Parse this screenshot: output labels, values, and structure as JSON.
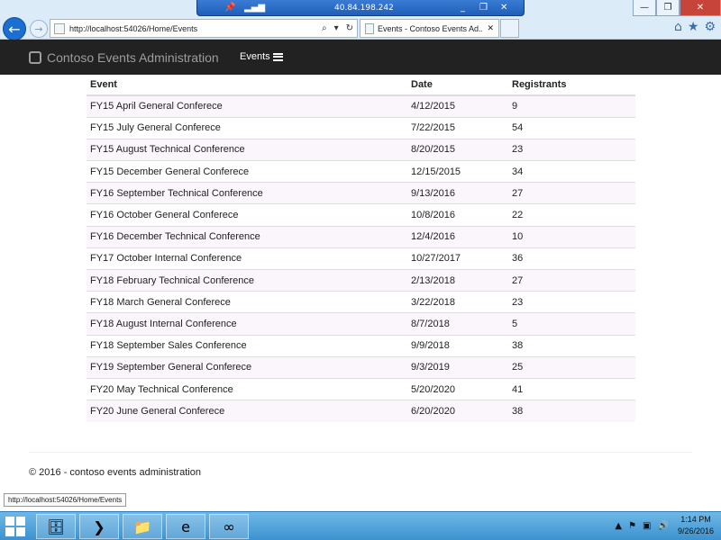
{
  "rdp": {
    "title": "40.84.198.242",
    "pin_icon": "pin-icon",
    "signal_icon": "signal-bars-icon",
    "minimize": "_",
    "restore": "❐",
    "close": "✕"
  },
  "browser": {
    "url": "http://localhost:54026/Home/Events",
    "tab_title": "Events - Contoso Events Ad...",
    "tab_close": "✕",
    "back_icon": "back-arrow-icon",
    "forward_icon": "forward-arrow-icon",
    "tool_icons": [
      "home-icon",
      "star-icon",
      "gear-icon"
    ]
  },
  "window": {
    "minimize": "—",
    "maximize": "❐",
    "close": "✕"
  },
  "navbar": {
    "brand": "Contoso Events Administration",
    "events_link": "Events"
  },
  "table": {
    "headers": {
      "event": "Event",
      "date": "Date",
      "registrants": "Registrants"
    },
    "rows": [
      {
        "event": "FY15 April General Conferece",
        "date": "4/12/2015",
        "registrants": "9"
      },
      {
        "event": "FY15 July General Conferece",
        "date": "7/22/2015",
        "registrants": "54"
      },
      {
        "event": "FY15 August Technical Conference",
        "date": "8/20/2015",
        "registrants": "23"
      },
      {
        "event": "FY15 December General Conferece",
        "date": "12/15/2015",
        "registrants": "34"
      },
      {
        "event": "FY16 September Technical Conference",
        "date": "9/13/2016",
        "registrants": "27"
      },
      {
        "event": "FY16 October General Conferece",
        "date": "10/8/2016",
        "registrants": "22"
      },
      {
        "event": "FY16 December Technical Conference",
        "date": "12/4/2016",
        "registrants": "10"
      },
      {
        "event": "FY17 October Internal Conference",
        "date": "10/27/2017",
        "registrants": "36"
      },
      {
        "event": "FY18 February Technical Conference",
        "date": "2/13/2018",
        "registrants": "27"
      },
      {
        "event": "FY18 March General Conferece",
        "date": "3/22/2018",
        "registrants": "23"
      },
      {
        "event": "FY18 August Internal Conference",
        "date": "8/7/2018",
        "registrants": "5"
      },
      {
        "event": "FY18 September Sales Conference",
        "date": "9/9/2018",
        "registrants": "38"
      },
      {
        "event": "FY19 September General Conferece",
        "date": "9/3/2019",
        "registrants": "25"
      },
      {
        "event": "FY20 May Technical Conference",
        "date": "5/20/2020",
        "registrants": "41"
      },
      {
        "event": "FY20 June General Conferece",
        "date": "6/20/2020",
        "registrants": "38"
      }
    ]
  },
  "footer": {
    "text": "© 2016 - contoso events administration"
  },
  "status_bar": {
    "tooltip": "http://localhost:54026/Home/Events"
  },
  "taskbar": {
    "apps": [
      "server-manager-icon",
      "powershell-icon",
      "file-explorer-icon",
      "internet-explorer-icon",
      "visual-studio-icon"
    ],
    "tray_icons": [
      "show-hidden-icons",
      "network-icon",
      "action-center-icon",
      "volume-icon"
    ],
    "time": "1:14 PM",
    "date": "9/26/2016"
  }
}
